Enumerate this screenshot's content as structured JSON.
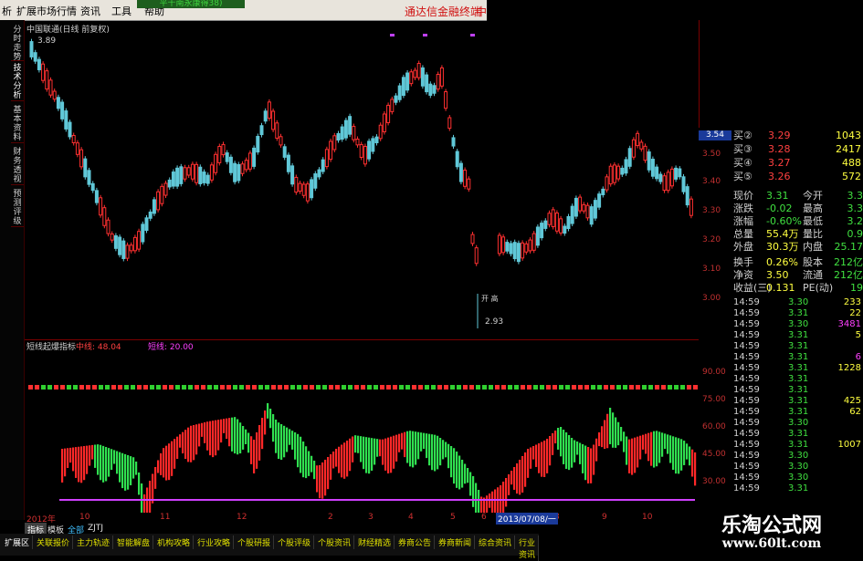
{
  "menu": {
    "items": [
      "析",
      "扩展市场行情",
      "资讯",
      "工具",
      "帮助"
    ],
    "brand": "通达信金融终端",
    "tail": "中",
    "top_tab": "平千南永康得38)"
  },
  "left_tabs": [
    "分时走势",
    "技术分析",
    "基本资料",
    "财务透视",
    "预测评级"
  ],
  "main_chart": {
    "title": "中国联通(日线 前复权)",
    "high_label": "3.89",
    "low_label": "2.93",
    "ohlc_tag": "开 高",
    "current_price_box": "3.54",
    "y_ticks": [
      "3.50",
      "3.40",
      "3.30",
      "3.20",
      "3.10",
      "3.00"
    ]
  },
  "indicator": {
    "name": "短线起爆指标",
    "mid_label": "中线: 48.04",
    "short_label": "短线: 20.00",
    "y_ticks": [
      "90.00",
      "75.00",
      "60.00",
      "45.00",
      "30.00"
    ]
  },
  "quote": {
    "bids": [
      {
        "label": "买②",
        "price": "3.29",
        "vol": "1043"
      },
      {
        "label": "买③",
        "price": "3.28",
        "vol": "2417"
      },
      {
        "label": "买④",
        "price": "3.27",
        "vol": "488"
      },
      {
        "label": "买⑤",
        "price": "3.26",
        "vol": "572"
      }
    ],
    "stats": [
      {
        "k1": "现价",
        "v1": "3.31",
        "k2": "今开",
        "v2": "3.3"
      },
      {
        "k1": "涨跌",
        "v1": "-0.02",
        "k2": "最高",
        "v2": "3.3"
      },
      {
        "k1": "涨幅",
        "v1": "-0.60%",
        "k2": "最低",
        "v2": "3.2"
      },
      {
        "k1": "总量",
        "v1": "55.4万",
        "k2": "量比",
        "v2": "0.9"
      },
      {
        "k1": "外盘",
        "v1": "30.3万",
        "k2": "内盘",
        "v2": "25.17"
      },
      {
        "k1": "换手",
        "v1": "0.26%",
        "k2": "股本",
        "v2": "212亿"
      },
      {
        "k1": "净资",
        "v1": "3.50",
        "k2": "流通",
        "v2": "212亿"
      },
      {
        "k1": "收益(三)",
        "v1": "0.131",
        "k2": "PE(动)",
        "v2": "19"
      }
    ],
    "trades": [
      {
        "time": "14:59",
        "price": "3.30",
        "vol": "233"
      },
      {
        "time": "14:59",
        "price": "3.31",
        "vol": "22"
      },
      {
        "time": "14:59",
        "price": "3.30",
        "vol": "3481"
      },
      {
        "time": "14:59",
        "price": "3.31",
        "vol": "5"
      },
      {
        "time": "14:59",
        "price": "3.31",
        "vol": ""
      },
      {
        "time": "14:59",
        "price": "3.31",
        "vol": "6"
      },
      {
        "time": "14:59",
        "price": "3.31",
        "vol": "1228"
      },
      {
        "time": "14:59",
        "price": "3.31",
        "vol": ""
      },
      {
        "time": "14:59",
        "price": "3.31",
        "vol": ""
      },
      {
        "time": "14:59",
        "price": "3.31",
        "vol": "425"
      },
      {
        "time": "14:59",
        "price": "3.31",
        "vol": "62"
      },
      {
        "time": "14:59",
        "price": "3.30",
        "vol": ""
      },
      {
        "time": "14:59",
        "price": "3.31",
        "vol": ""
      },
      {
        "time": "14:59",
        "price": "3.31",
        "vol": "1007"
      },
      {
        "time": "14:59",
        "price": "3.30",
        "vol": ""
      },
      {
        "time": "14:59",
        "price": "3.30",
        "vol": ""
      },
      {
        "time": "14:59",
        "price": "3.30",
        "vol": ""
      },
      {
        "time": "14:59",
        "price": "3.31",
        "vol": ""
      }
    ]
  },
  "xaxis": {
    "labels": [
      "2012年",
      "10",
      "11",
      "12",
      "2",
      "3",
      "4",
      "5",
      "6",
      "7",
      "8",
      "9",
      "10",
      "11"
    ],
    "cursor_date": "2013/07/08/一"
  },
  "view_tabs": [
    "指标",
    "模板",
    "全部",
    "ZJTJ"
  ],
  "bottom_tabs": [
    "扩展区",
    "关联报价",
    "主力轨迹",
    "智能解盘",
    "机构攻略",
    "行业攻略",
    "个股研报",
    "个股评级",
    "个股资讯",
    "财经精选",
    "券商公告",
    "券商新闻",
    "综合资讯",
    "行业资讯"
  ],
  "watermark": {
    "title": "乐淘公式网",
    "url": "www.60lt.com"
  },
  "colors": {
    "up": "#ff3030",
    "down": "#30c0d0",
    "accent": "#d01010"
  }
}
